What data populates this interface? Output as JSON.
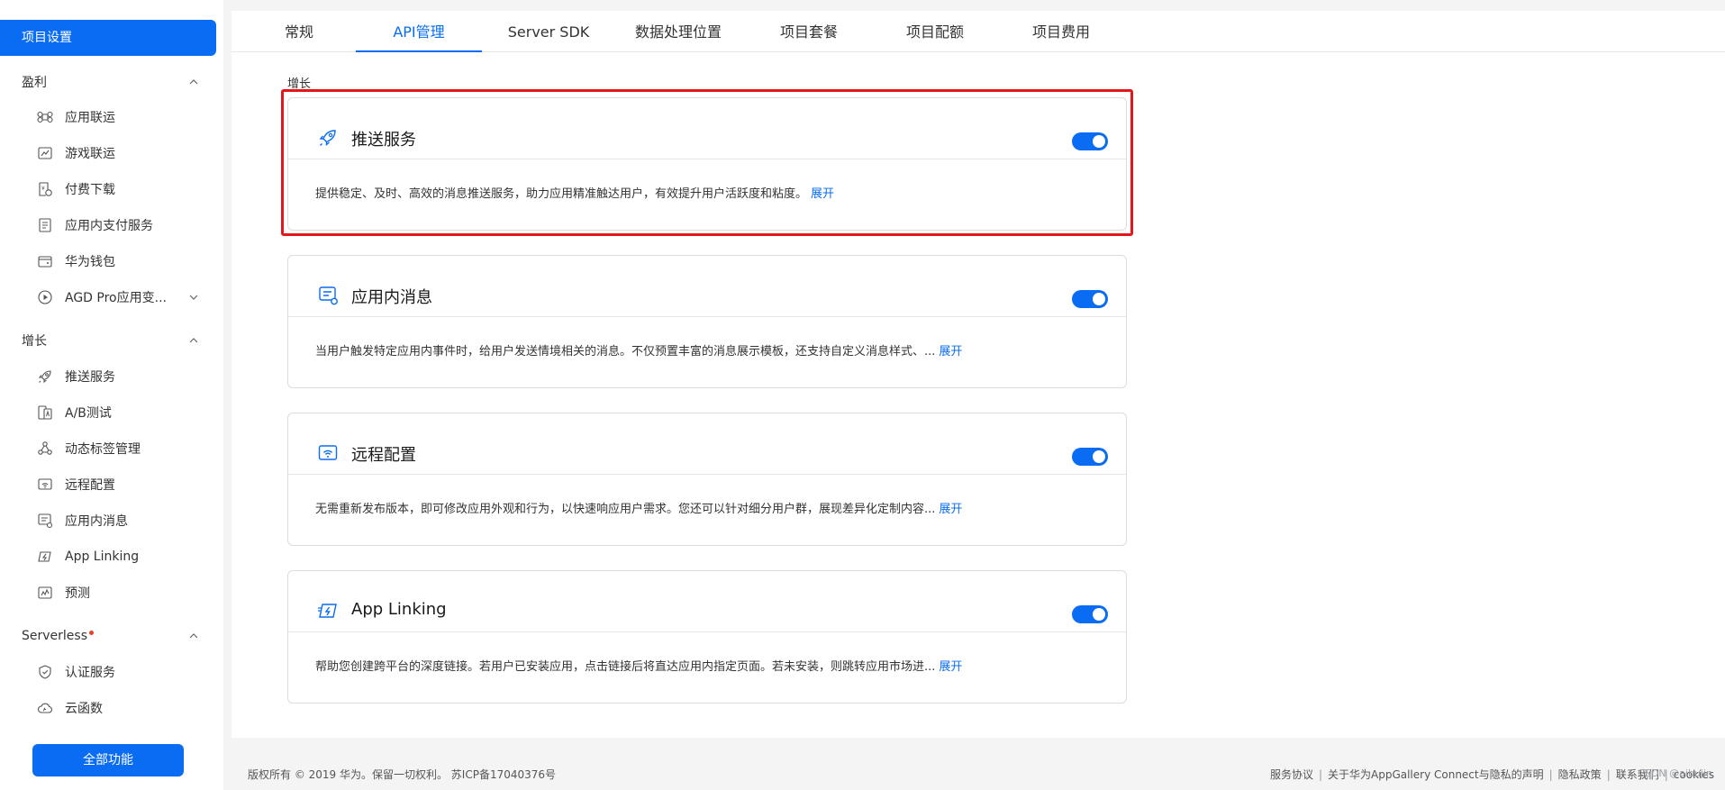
{
  "sidebar": {
    "top_item": "项目设置",
    "groups": [
      {
        "title": "盈利",
        "items": [
          {
            "label": "应用联运",
            "icon": "command-icon"
          },
          {
            "label": "游戏联运",
            "icon": "gamepad-icon"
          },
          {
            "label": "付费下载",
            "icon": "paid-download-icon"
          },
          {
            "label": "应用内支付服务",
            "icon": "receipt-icon"
          },
          {
            "label": "华为钱包",
            "icon": "wallet-icon"
          },
          {
            "label": "AGD Pro应用变...",
            "icon": "play-circle-icon"
          }
        ]
      },
      {
        "title": "增长",
        "items": [
          {
            "label": "推送服务",
            "icon": "rocket-icon"
          },
          {
            "label": "A/B测试",
            "icon": "ab-test-icon"
          },
          {
            "label": "动态标签管理",
            "icon": "tag-network-icon"
          },
          {
            "label": "远程配置",
            "icon": "remote-config-icon"
          },
          {
            "label": "应用内消息",
            "icon": "message-icon"
          },
          {
            "label": "App Linking",
            "icon": "link-icon"
          },
          {
            "label": "预测",
            "icon": "prediction-icon"
          }
        ]
      },
      {
        "title": "Serverless",
        "items": [
          {
            "label": "认证服务",
            "icon": "shield-check-icon"
          },
          {
            "label": "云函数",
            "icon": "cloud-function-icon"
          }
        ]
      }
    ],
    "all_features_button": "全部功能"
  },
  "tabs": [
    {
      "label": "常规",
      "active": false
    },
    {
      "label": "API管理",
      "active": true
    },
    {
      "label": "Server SDK",
      "active": false
    },
    {
      "label": "数据处理位置",
      "active": false
    },
    {
      "label": "项目套餐",
      "active": false
    },
    {
      "label": "项目配额",
      "active": false
    },
    {
      "label": "项目费用",
      "active": false
    }
  ],
  "section_label": "增长",
  "cards": [
    {
      "title": "推送服务",
      "icon": "rocket-icon",
      "enabled": true,
      "description": "提供稳定、及时、高效的消息推送服务，助力应用精准触达用户，有效提升用户活跃度和粘度。",
      "expand": "展开"
    },
    {
      "title": "应用内消息",
      "icon": "message-icon",
      "enabled": true,
      "description": "当用户触发特定应用内事件时，给用户发送情境相关的消息。不仅预置丰富的消息展示模板，还支持自定义消息样式、...",
      "expand": "展开"
    },
    {
      "title": "远程配置",
      "icon": "remote-config-icon",
      "enabled": true,
      "description": "无需重新发布版本，即可修改应用外观和行为，以快速响应用户需求。您还可以针对细分用户群，展现差异化定制内容...",
      "expand": "展开"
    },
    {
      "title": "App Linking",
      "icon": "link-icon",
      "enabled": true,
      "description": "帮助您创建跨平台的深度链接。若用户已安装应用，点击链接后将直达应用内指定页面。若未安装，则跳转应用市场进...",
      "expand": "展开"
    }
  ],
  "footer": {
    "copyright": "版权所有 © 2019 华为。保留一切权利。 苏ICP备17040376号",
    "links": [
      "服务协议",
      "关于华为AppGallery Connect与隐私的声明",
      "隐私政策",
      "联系我们",
      "cookies"
    ]
  },
  "watermark": "CSDN @aibujin",
  "colors": {
    "accent": "#0a6cf3",
    "highlight_border": "#e3161b",
    "background": "#f4f4f5"
  }
}
